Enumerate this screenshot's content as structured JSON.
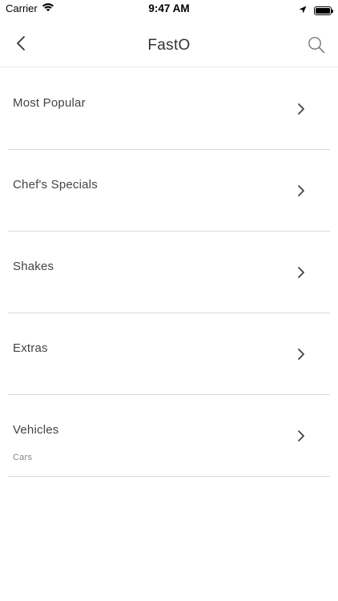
{
  "status_bar": {
    "carrier": "Carrier",
    "time": "9:47 AM",
    "icons": [
      "wifi-icon",
      "location-arrow-icon",
      "battery-icon"
    ]
  },
  "nav": {
    "title": "FastO",
    "back_icon": "chevron-left-icon",
    "search_icon": "search-icon"
  },
  "list": {
    "items": [
      {
        "label": "Most Popular",
        "subtitle": ""
      },
      {
        "label": "Chef's Specials",
        "subtitle": ""
      },
      {
        "label": "Shakes",
        "subtitle": ""
      },
      {
        "label": "Extras",
        "subtitle": ""
      },
      {
        "label": "Vehicles",
        "subtitle": "Cars"
      }
    ],
    "chevron_icon": "chevron-right-icon"
  }
}
